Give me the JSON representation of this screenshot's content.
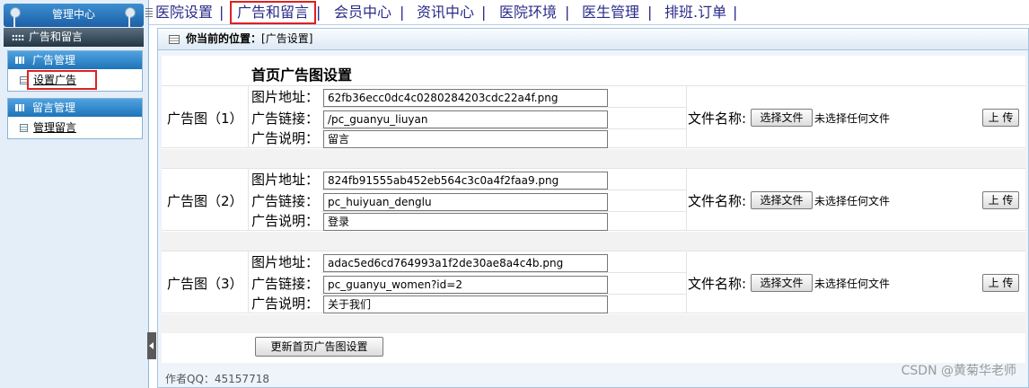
{
  "sidebar": {
    "title": "管理中心",
    "section": "广告和留言",
    "panels": [
      {
        "header": "广告管理",
        "items": [
          {
            "label": "设置广告"
          }
        ]
      },
      {
        "header": "留言管理",
        "items": [
          {
            "label": "管理留言"
          }
        ]
      }
    ]
  },
  "nav": {
    "items": [
      "医院设置",
      "广告和留言",
      "会员中心",
      "资讯中心",
      "医院环境",
      "医生管理",
      "排班.订单"
    ],
    "separator": "|"
  },
  "location": {
    "label": "你当前的位置：",
    "value": "[广告设置]"
  },
  "form": {
    "heading": "首页广告图设置",
    "field_labels": {
      "image": "图片地址：",
      "link": "广告链接：",
      "desc": "广告说明："
    },
    "file_label": "文件名称:",
    "choose_file": "选择文件",
    "no_file": "未选择任何文件",
    "upload": "上 传",
    "ads": [
      {
        "title": "广告图（1）",
        "image": "62fb36ecc0dc4c0280284203cdc22a4f.png",
        "link": "/pc_guanyu_liuyan",
        "desc": "留言"
      },
      {
        "title": "广告图（2）",
        "image": "824fb91555ab452eb564c3c0a4f2faa9.png",
        "link": "pc_huiyuan_denglu",
        "desc": "登录"
      },
      {
        "title": "广告图（3）",
        "image": "adac5ed6cd764993a1f2de30ae8a4c4b.png",
        "link": "pc_guanyu_women?id=2",
        "desc": "关于我们"
      }
    ],
    "submit": "更新首页广告图设置"
  },
  "footer": {
    "author": "作者QQ：45157718"
  },
  "watermark": "CSDN @黄菊华老师",
  "colors": {
    "highlight_box": "#e02020",
    "nav_text": "#2a2a8a",
    "sidebar_header": "#1f74b8"
  }
}
